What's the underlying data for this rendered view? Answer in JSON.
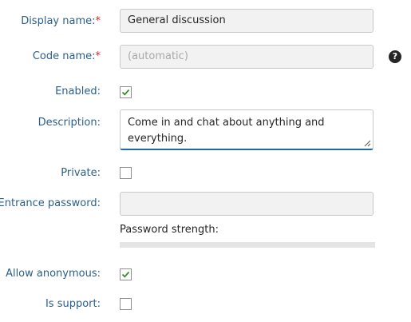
{
  "form": {
    "display_name": {
      "label": "Display name:",
      "required_mark": "*",
      "value": "General discussion"
    },
    "code_name": {
      "label": "Code name:",
      "required_mark": "*",
      "placeholder": "(automatic)",
      "help_icon": "question-circle-icon",
      "help_glyph": "?"
    },
    "enabled": {
      "label": "Enabled:",
      "checked": true
    },
    "description": {
      "label": "Description:",
      "value": "Come in and chat about anything and everything."
    },
    "private": {
      "label": "Private:",
      "checked": false
    },
    "entrance_password": {
      "label": "Entrance password:",
      "value": "",
      "strength_label": "Password strength:",
      "strength_fraction": 0
    },
    "allow_anonymous": {
      "label": "Allow anonymous:",
      "checked": true
    },
    "is_support": {
      "label": "Is support:",
      "checked": false
    }
  },
  "colors": {
    "label": "#2b5f8a",
    "required": "#d9232e",
    "checkmark": "#3c8a2e",
    "focus_border": "#1f6aa5",
    "field_background": "#f2f2f2"
  }
}
